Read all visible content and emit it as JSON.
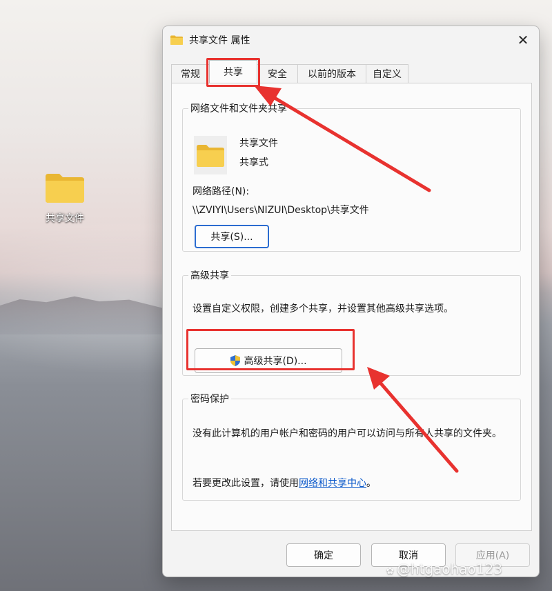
{
  "desktop": {
    "icon_label": "共享文件"
  },
  "dialog": {
    "title": "共享文件 属性",
    "close_glyph": "✕",
    "tabs": [
      {
        "label": "常规"
      },
      {
        "label": "共享"
      },
      {
        "label": "安全"
      },
      {
        "label": "以前的版本"
      },
      {
        "label": "自定义"
      }
    ],
    "network_sharing": {
      "legend": "网络文件和文件夹共享",
      "folder_name": "共享文件",
      "share_status": "共享式",
      "path_label": "网络路径(N):",
      "path_value": "\\\\ZVIYI\\Users\\NIZUI\\Desktop\\共享文件",
      "share_button": "共享(S)..."
    },
    "advanced_sharing": {
      "legend": "高级共享",
      "description": "设置自定义权限，创建多个共享，并设置其他高级共享选项。",
      "button": "高级共享(D)..."
    },
    "password_protection": {
      "legend": "密码保护",
      "description": "没有此计算机的用户帐户和密码的用户可以访问与所有人共享的文件夹。",
      "change_prefix": "若要更改此设置，请使用",
      "change_link": "网络和共享中心",
      "change_suffix": "。"
    },
    "footer": {
      "ok": "确定",
      "cancel": "取消",
      "apply": "应用(A)"
    }
  },
  "watermark": {
    "text": "@htgaohao123"
  },
  "colors": {
    "annotation": "#e8322f",
    "folder": "#f5c842",
    "link": "#0a58ca",
    "focus": "#2b6cd0"
  }
}
